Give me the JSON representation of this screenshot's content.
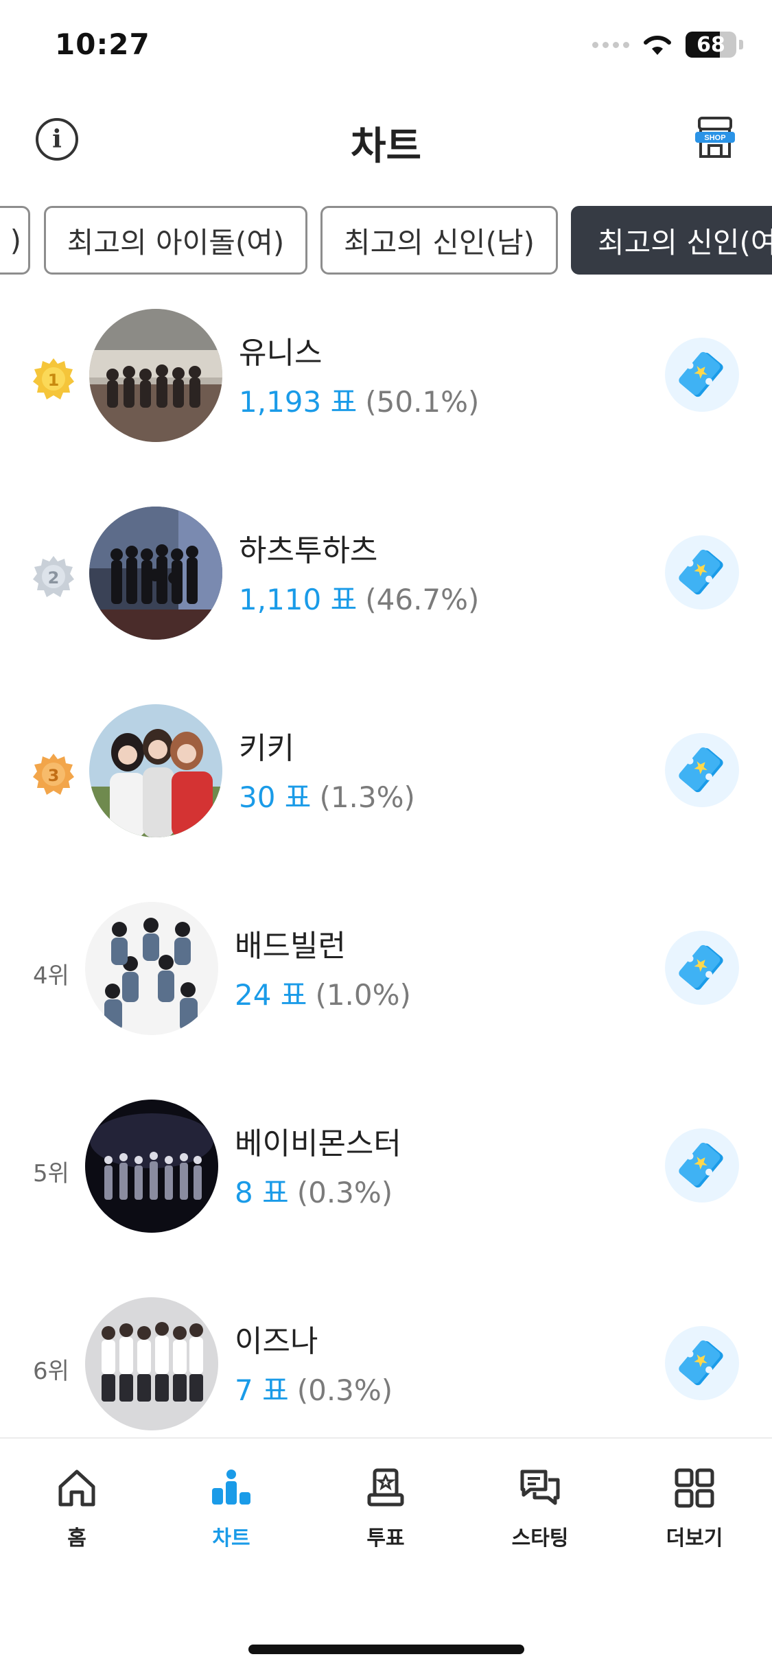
{
  "status_bar": {
    "time": "10:27",
    "battery": "68",
    "battery_level": 0.68
  },
  "header": {
    "title": "차트"
  },
  "tabs": [
    {
      "label": ")"
    },
    {
      "label": "최고의 아이돌(여)"
    },
    {
      "label": "최고의 신인(남)"
    },
    {
      "label": "최고의 신인(여)",
      "active": true
    }
  ],
  "chart_items": [
    {
      "rank": "1",
      "rank_label": "",
      "medal": "gold",
      "name": "유니스",
      "votes": "1,193 표",
      "percent": "(50.1%)"
    },
    {
      "rank": "2",
      "rank_label": "",
      "medal": "silver",
      "name": "하츠투하츠",
      "votes": "1,110 표",
      "percent": "(46.7%)"
    },
    {
      "rank": "3",
      "rank_label": "",
      "medal": "bronze",
      "name": "키키",
      "votes": "30 표",
      "percent": "(1.3%)"
    },
    {
      "rank": "4",
      "rank_label": "4위",
      "medal": "none",
      "name": "배드빌런",
      "votes": "24 표",
      "percent": "(1.0%)"
    },
    {
      "rank": "5",
      "rank_label": "5위",
      "medal": "none",
      "name": "베이비몬스터",
      "votes": "8 표",
      "percent": "(0.3%)"
    },
    {
      "rank": "6",
      "rank_label": "6위",
      "medal": "none",
      "name": "이즈나",
      "votes": "7 표",
      "percent": "(0.3%)"
    }
  ],
  "bottom_nav": [
    {
      "label": "홈",
      "icon": "home-icon",
      "active": false
    },
    {
      "label": "차트",
      "icon": "chart-icon",
      "active": true
    },
    {
      "label": "투표",
      "icon": "vote-icon",
      "active": false
    },
    {
      "label": "스타팅",
      "icon": "chat-icon",
      "active": false
    },
    {
      "label": "더보기",
      "icon": "grid-icon",
      "active": false
    }
  ],
  "colors": {
    "accent": "#1a9be8",
    "active_tab": "#363b44",
    "gold": "#f5c53a",
    "silver": "#c9d0d8",
    "bronze": "#f2a54a"
  },
  "shop_badge": "SHOP"
}
